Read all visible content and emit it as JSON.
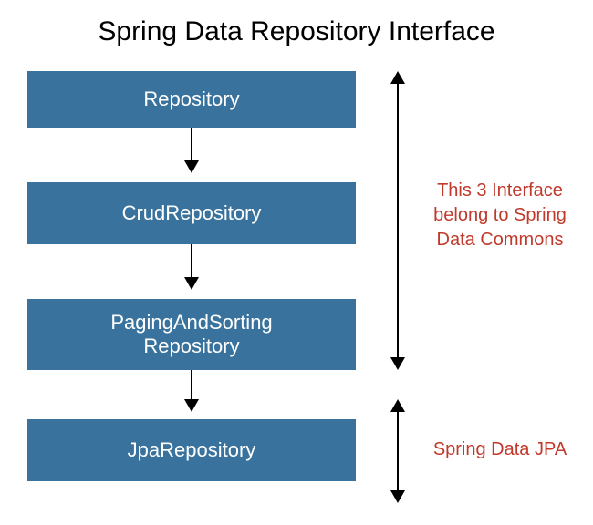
{
  "title": "Spring Data Repository Interface",
  "boxes": {
    "repository": "Repository",
    "crud": "CrudRepository",
    "paging_line1": "PagingAndSorting",
    "paging_line2": "Repository",
    "jpa": "JpaRepository"
  },
  "annotations": {
    "commons": "This 3 Interface\nbelong to Spring\nData Commons",
    "jpa": "Spring Data JPA"
  },
  "colors": {
    "box_bg": "#39739d",
    "box_fg": "#ffffff",
    "annotation": "#c0392b"
  }
}
